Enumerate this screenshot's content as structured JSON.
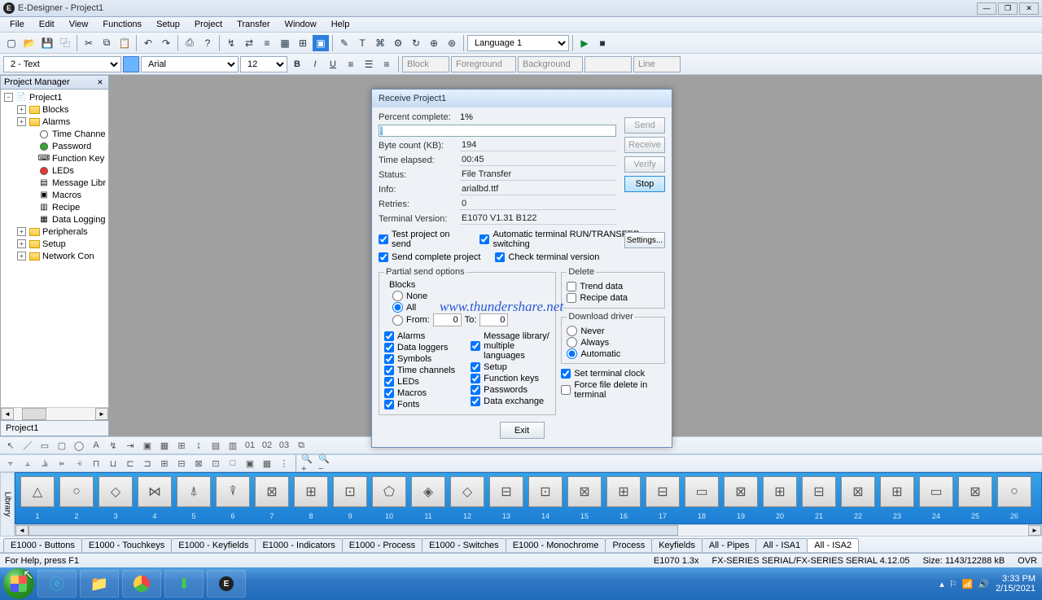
{
  "title": "E-Designer - Project1",
  "menus": [
    "File",
    "Edit",
    "View",
    "Functions",
    "Setup",
    "Project",
    "Transfer",
    "Window",
    "Help"
  ],
  "toolbar1": {
    "language": "Language 1"
  },
  "toolbar2": {
    "format": "2 - Text",
    "font": "Arial",
    "size": "12",
    "block": "Block",
    "fg": "Foreground",
    "bg": "Background",
    "line": "Line"
  },
  "pm": {
    "title": "Project Manager",
    "root": "Project1",
    "items": [
      "Blocks",
      "Alarms",
      "Time Channe",
      "Password",
      "Function Key",
      "LEDs",
      "Message Libr",
      "Macros",
      "Recipe",
      "Data Logging",
      "Peripherals",
      "Setup",
      "Network Con"
    ],
    "tab": "Project1"
  },
  "dialog": {
    "title": "Receive Project1",
    "rows": {
      "percent_label": "Percent complete:",
      "percent_val": "1%",
      "bytecount_label": "Byte count (KB):",
      "bytecount_val": "194",
      "elapsed_label": "Time elapsed:",
      "elapsed_val": "00:45",
      "status_label": "Status:",
      "status_val": "File Transfer",
      "info_label": "Info:",
      "info_val": "arialbd.ttf",
      "retries_label": "Retries:",
      "retries_val": "0",
      "termver_label": "Terminal Version:",
      "termver_val": "E1070 V1.31 B122"
    },
    "btns": {
      "send": "Send",
      "receive": "Receive",
      "verify": "Verify",
      "stop": "Stop",
      "settings": "Settings...",
      "exit": "Exit"
    },
    "checks": {
      "test_send": "Test project on send",
      "auto_run": "Automatic terminal RUN/TRANSFER switching",
      "send_complete": "Send complete project",
      "check_term": "Check terminal version"
    },
    "partial": {
      "legend": "Partial send options",
      "blocks": "Blocks",
      "none": "None",
      "all": "All",
      "from": "From:",
      "to": "To:",
      "from_val": "0",
      "to_val": "0",
      "alarms": "Alarms",
      "dataloggers": "Data loggers",
      "symbols": "Symbols",
      "timechannels": "Time channels",
      "leds": "LEDs",
      "macros": "Macros",
      "fonts": "Fonts",
      "msglib": "Message library/ multiple languages",
      "setup": "Setup",
      "funckeys": "Function keys",
      "passwords": "Passwords",
      "dataexch": "Data exchange"
    },
    "delete": {
      "legend": "Delete",
      "trend": "Trend data",
      "recipe": "Recipe data"
    },
    "driver": {
      "legend": "Download driver",
      "never": "Never",
      "always": "Always",
      "auto": "Automatic"
    },
    "clock": "Set terminal clock",
    "force": "Force file delete in terminal"
  },
  "watermark": "www.thundershare.net",
  "libtabs": [
    "E1000 - Buttons",
    "E1000 - Touchkeys",
    "E1000 - Keyfields",
    "E1000 - Indicators",
    "E1000 - Process",
    "E1000 - Switches",
    "E1000 - Monochrome",
    "Process",
    "Keyfields",
    "All - Pipes",
    "All - ISA1",
    "All - ISA2"
  ],
  "statusbar": {
    "help": "For Help, press F1",
    "device": "E1070 1.3x",
    "serial": "FX-SERIES SERIAL/FX-SERIES SERIAL 4.12.05",
    "size": "Size: 1143/12288 kB",
    "ovr": "OVR"
  },
  "tray": {
    "time": "3:33 PM",
    "date": "2/15/2021"
  }
}
